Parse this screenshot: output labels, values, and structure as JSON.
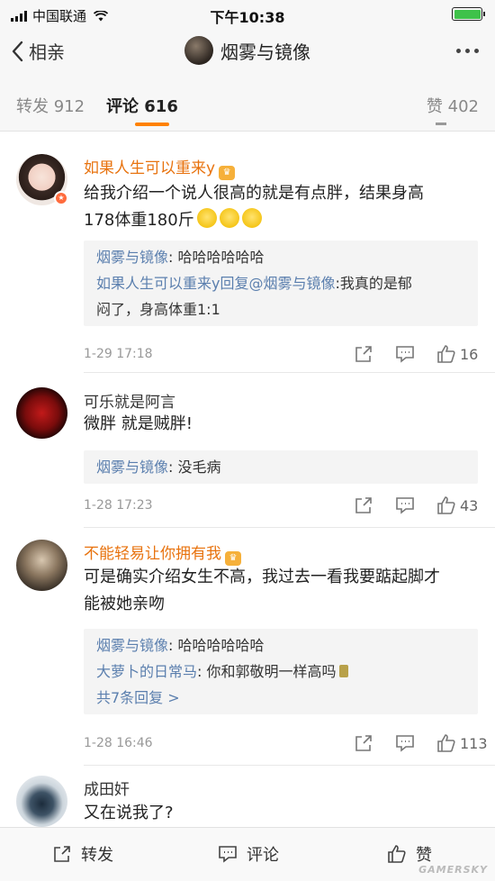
{
  "status_bar": {
    "carrier": "中国联通",
    "time": "下午10:38"
  },
  "nav": {
    "back_label": "相亲",
    "title": "烟雾与镜像"
  },
  "tabs": {
    "repost": "转发 912",
    "comment": "评论 616",
    "like": "赞 402"
  },
  "comments": [
    {
      "name": "如果人生可以重来y",
      "text_line1": "给我介绍一个说人很高的就是有点胖，结果身高",
      "text_line2": "178体重180斤",
      "replies": [
        {
          "who": "烟雾与镜像",
          "text": ": 哈哈哈哈哈哈"
        },
        {
          "who": "如果人生可以重来y回复@烟雾与镜像",
          "text": ":我真的是郁"
        },
        {
          "who": "",
          "text": "闷了，身高体重1:1"
        }
      ],
      "time": "1-29 17:18",
      "likes": "16"
    },
    {
      "name": "可乐就是阿言",
      "text_line1": "微胖 就是贼胖!",
      "replies": [
        {
          "who": "烟雾与镜像",
          "text": ": 没毛病"
        }
      ],
      "time": "1-28 17:23",
      "likes": "43"
    },
    {
      "name": "不能轻易让你拥有我",
      "text_line1": "可是确实介绍女生不高，我过去一看我要踮起脚才",
      "text_line2": "能被她亲吻",
      "replies": [
        {
          "who": "烟雾与镜像",
          "text": ": 哈哈哈哈哈哈"
        },
        {
          "who": "大萝卜的日常马",
          "text": ": 你和郭敬明一样高吗"
        }
      ],
      "more_replies": "共7条回复 >",
      "time": "1-28 16:46",
      "likes": "113"
    },
    {
      "name": "成田奸",
      "text_line1": "又在说我了?"
    }
  ],
  "bottom_bar": {
    "repost": "转发",
    "comment": "评论",
    "like": "赞"
  },
  "watermark": "GAMERSKY",
  "colors": {
    "accent": "#ff8200",
    "vip_name": "#e8730f",
    "link": "#5b7fae"
  }
}
